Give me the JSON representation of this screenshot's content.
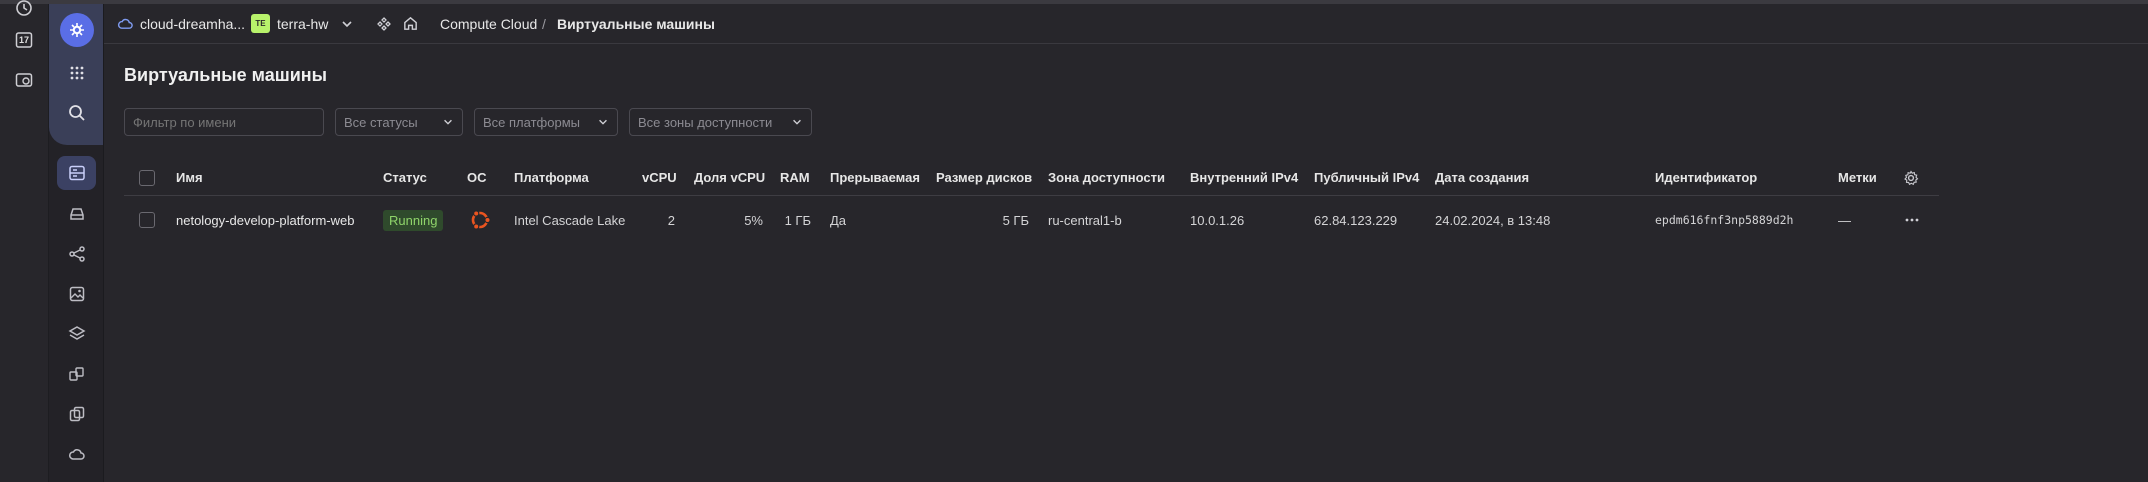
{
  "header": {
    "cloud_name": "cloud-dreamha...",
    "folder_badge": "TE",
    "folder_name": "terra-hw",
    "service_name": "Compute Cloud",
    "separator": "/",
    "current_page": "Виртуальные машины"
  },
  "sysbar": {
    "calendar_day": "17"
  },
  "page": {
    "title": "Виртуальные машины"
  },
  "filters": {
    "name_placeholder": "Фильтр по имени",
    "status_label": "Все статусы",
    "platform_label": "Все платформы",
    "zone_label": "Все зоны доступности"
  },
  "table": {
    "columns": {
      "name": "Имя",
      "status": "Статус",
      "os": "ОС",
      "platform": "Платформа",
      "vcpu": "vCPU",
      "vcpu_share": "Доля vCPU",
      "ram": "RAM",
      "preemptible": "Прерываемая",
      "disk_size": "Размер дисков",
      "zone": "Зона доступности",
      "internal_ip": "Внутренний IPv4",
      "public_ip": "Публичный IPv4",
      "created": "Дата создания",
      "id": "Идентификатор",
      "labels": "Метки"
    },
    "rows": [
      {
        "name": "netology-develop-platform-web",
        "status": "Running",
        "os_icon": "ubuntu-icon",
        "platform": "Intel Cascade Lake",
        "vcpu": "2",
        "vcpu_share": "5%",
        "ram": "1 ГБ",
        "preemptible": "Да",
        "disk_size": "5 ГБ",
        "zone": "ru-central1-b",
        "internal_ip": "10.0.1.26",
        "public_ip": "62.84.123.229",
        "created": "24.02.2024, в 13:48",
        "id": "epdm616fnf3np5889d2h",
        "labels": "—"
      }
    ]
  },
  "colors": {
    "background": "#27262b",
    "accent": "#5a6ee6",
    "status_running": "#8fd46a",
    "ubuntu_orange": "#e95420",
    "folder_badge": "#b8f26b"
  }
}
